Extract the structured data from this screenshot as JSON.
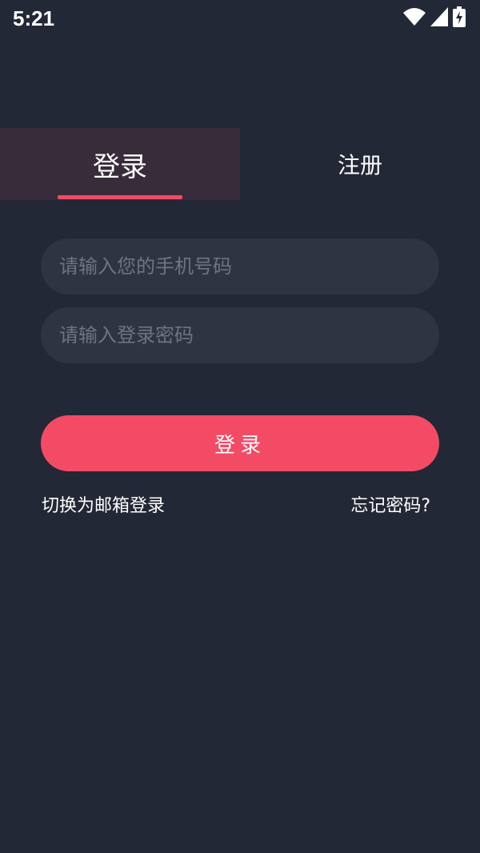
{
  "status_bar": {
    "time": "5:21",
    "icons": [
      "wifi-icon",
      "signal-icon",
      "battery-charging-icon"
    ]
  },
  "tabs": [
    {
      "label": "登录",
      "active": true
    },
    {
      "label": "注册",
      "active": false
    }
  ],
  "form": {
    "phone_placeholder": "请输入您的手机号码",
    "phone_value": "",
    "password_placeholder": "请输入登录密码",
    "password_value": "",
    "submit_label": "登录"
  },
  "links": {
    "switch_email": "切换为邮箱登录",
    "forgot_password": "忘记密码?"
  },
  "colors": {
    "background": "#232836",
    "accent": "#f34a66",
    "field_background": "#2f3441",
    "active_tab_background": "#382b3a",
    "placeholder": "#6f7482"
  }
}
